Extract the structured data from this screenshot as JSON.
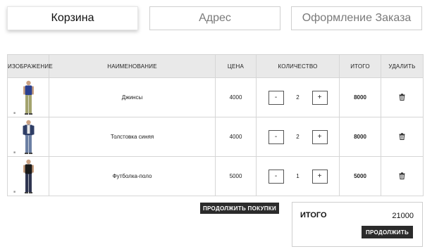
{
  "steps": [
    {
      "label": "Корзина",
      "active": true
    },
    {
      "label": "Адрес",
      "active": false
    },
    {
      "label": "Оформление Заказа",
      "active": false
    }
  ],
  "table": {
    "headers": {
      "image": "ИЗОБРАЖЕНИЕ",
      "name": "НАИМЕНОВАНИЕ",
      "price": "ЦЕНА",
      "quantity": "КОЛИЧЕСТВО",
      "total": "ИТОГО",
      "delete": "УДАЛИТЬ"
    },
    "rows": [
      {
        "name": "Джинсы",
        "price": "4000",
        "quantity": "2",
        "total": "8000",
        "shirt_color": "#2a3f8f",
        "pants_color": "#a3a36e"
      },
      {
        "name": "Толстовка синяя",
        "price": "4000",
        "quantity": "2",
        "total": "8000",
        "shirt_color": "#2f3e66",
        "pants_color": "#6b7fa3"
      },
      {
        "name": "Футболка-поло",
        "price": "5000",
        "quantity": "1",
        "total": "5000",
        "shirt_color": "#1a1a1a",
        "pants_color": "#2e3550"
      }
    ],
    "minus_label": "-",
    "plus_label": "+"
  },
  "actions": {
    "continue_label": "ПРОДОЛЖИТЬ ПОКУПКИ",
    "checkout_label": "ПРОДОЛЖИТЬ"
  },
  "summary": {
    "label": "ИТОГО",
    "value": "21000"
  },
  "icons": {
    "delete": "trash-icon"
  }
}
